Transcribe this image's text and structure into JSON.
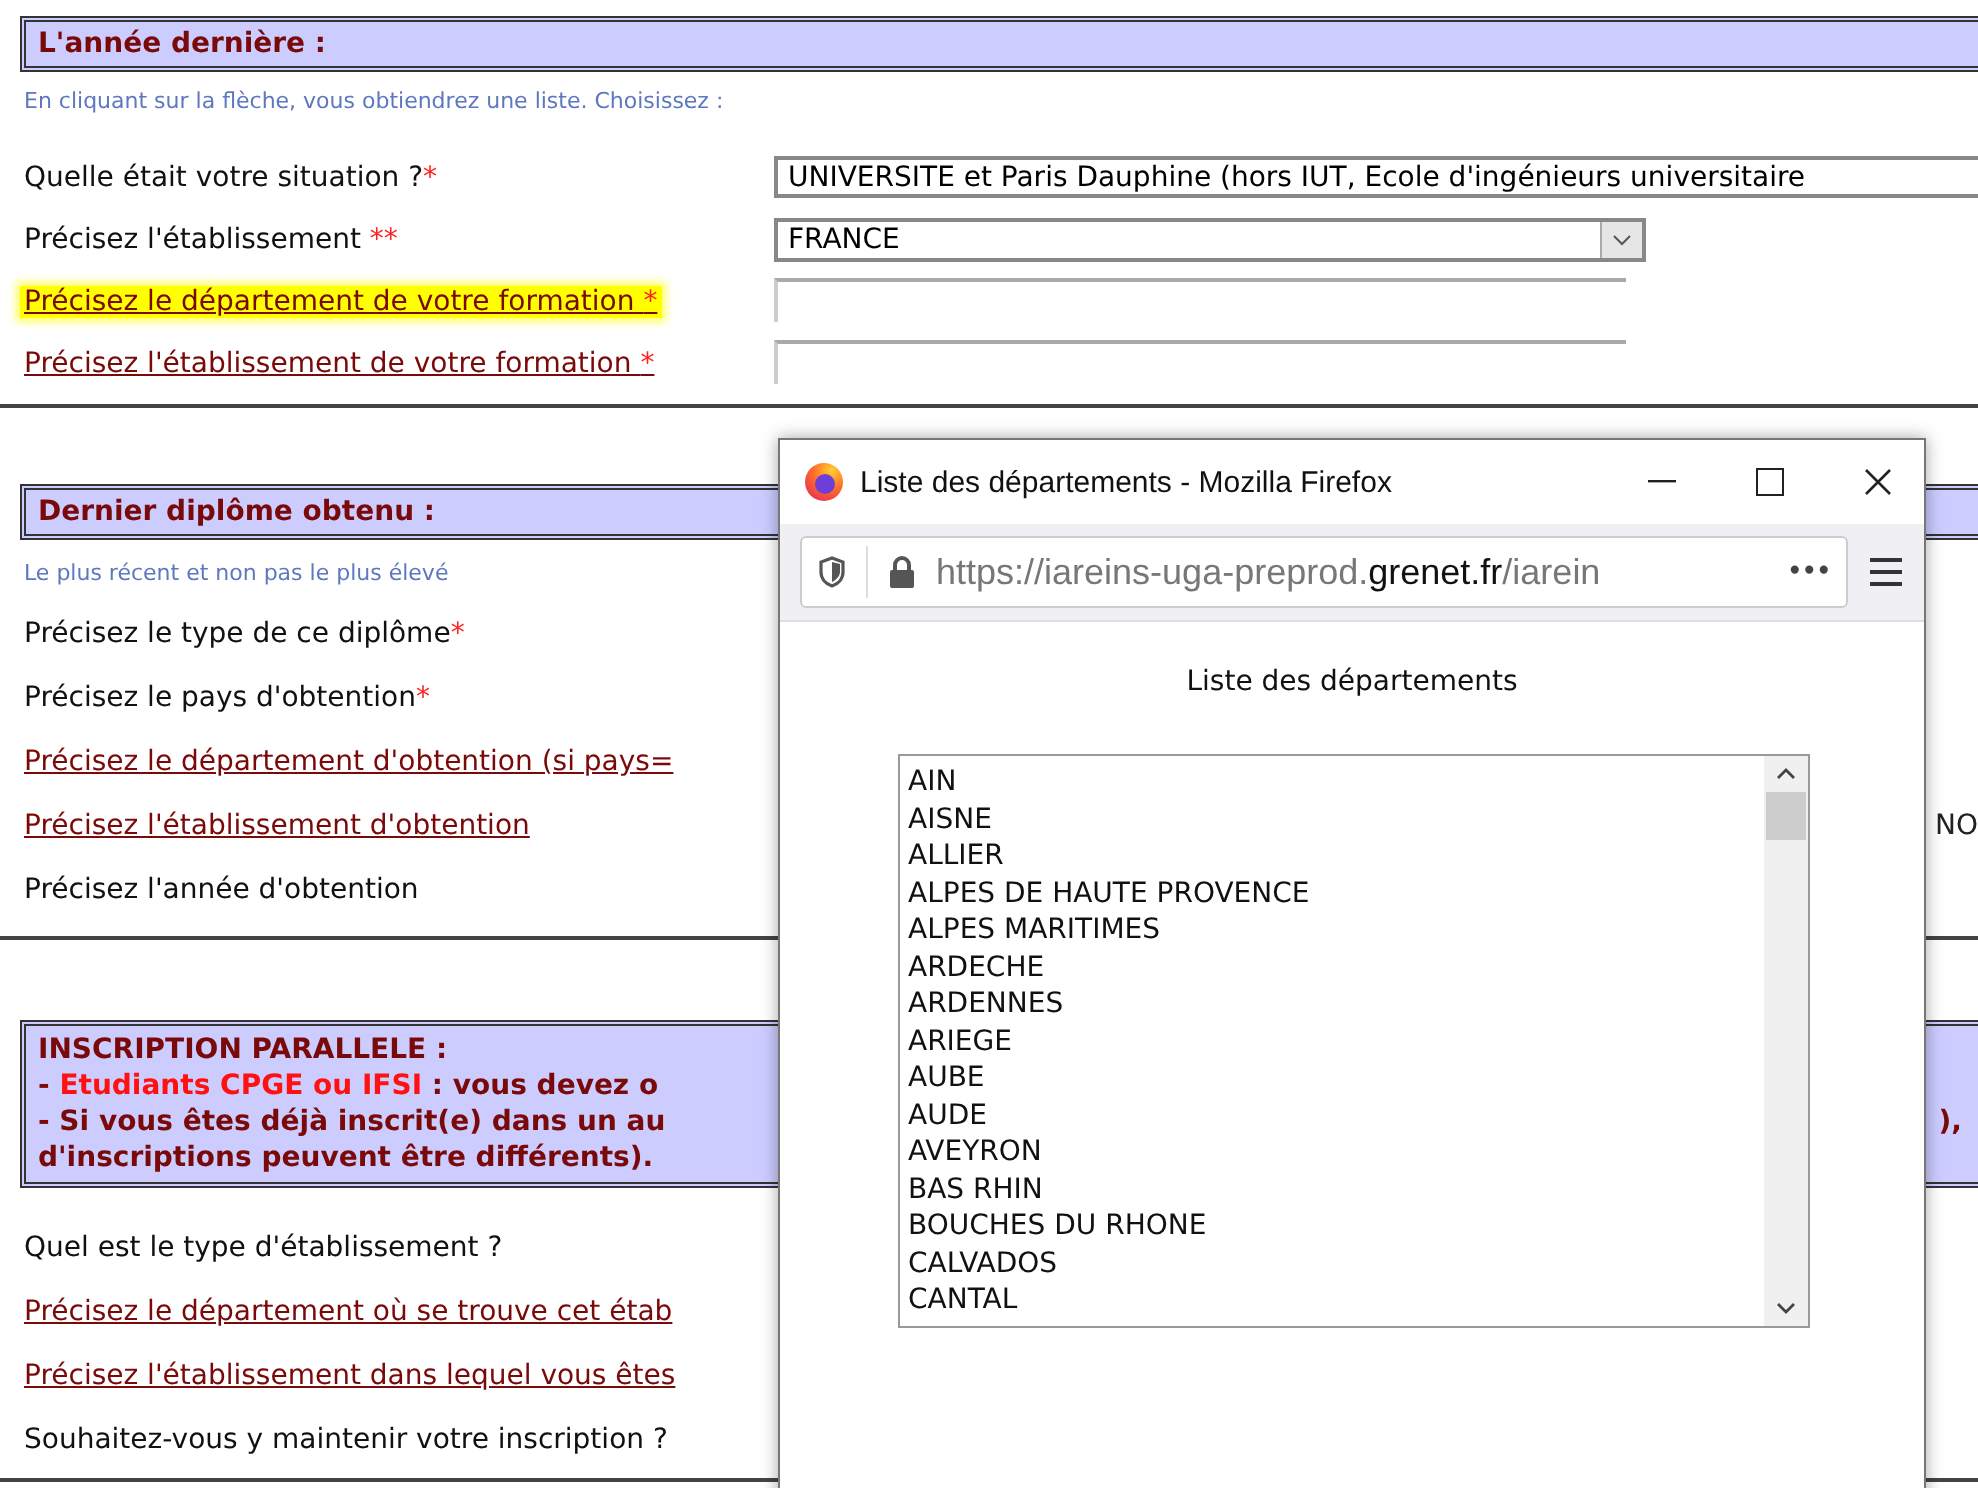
{
  "sections": [
    {
      "title_lines": [
        [
          {
            "text": "L'année dernière :"
          }
        ]
      ],
      "hint": "En cliquant sur la flèche, vous obtiendrez une liste. Choisissez :",
      "rows": [
        {
          "label": "Quelle était votre situation ?",
          "required": "*",
          "link": false,
          "highlighted": false,
          "field": {
            "kind": "wide-select",
            "value": "UNIVERSITE et Paris Dauphine (hors IUT, Ecole d'ingénieurs universitaire"
          }
        },
        {
          "label": "Précisez l'établissement ",
          "required": "**",
          "link": false,
          "highlighted": false,
          "field": {
            "kind": "select",
            "value": "FRANCE"
          }
        },
        {
          "label": "Précisez le département de votre formation ",
          "required": "*",
          "link": true,
          "highlighted": true,
          "field": {
            "kind": "text"
          }
        },
        {
          "label": "Précisez l'établissement de votre formation ",
          "required": "*",
          "link": true,
          "highlighted": false,
          "field": {
            "kind": "text"
          }
        }
      ]
    },
    {
      "title_lines": [
        [
          {
            "text": "Dernier diplôme obtenu :"
          }
        ]
      ],
      "hint": "Le plus récent et non pas le plus élevé",
      "rows": [
        {
          "label": "Précisez le type de ce diplôme",
          "required": "*",
          "link": false,
          "highlighted": false
        },
        {
          "label": "Précisez le pays d'obtention",
          "required": "*",
          "link": false,
          "highlighted": false
        },
        {
          "label": "Précisez le département d'obtention (si pays=",
          "link": true,
          "highlighted": false
        },
        {
          "label": "Précisez l'établissement d'obtention",
          "link": true,
          "highlighted": false,
          "right_text": "NO"
        },
        {
          "label": "Précisez l'année d'obtention",
          "link": false,
          "highlighted": false
        }
      ]
    },
    {
      "title_lines": [
        [
          {
            "text": "INSCRIPTION PARALLELE :"
          }
        ],
        [
          {
            "text": "- "
          },
          {
            "text": "Etudiants CPGE ou IFSI",
            "emphasis": true
          },
          {
            "text": " : vous devez o"
          }
        ],
        [
          {
            "text": "- Si vous êtes déjà inscrit(e) dans un au"
          },
          {
            "text": "),",
            "right": true
          }
        ],
        [
          {
            "text": "d'inscriptions peuvent être différents)."
          }
        ]
      ],
      "rows": [
        {
          "label": "Quel est le type d'établissement ?",
          "link": false,
          "highlighted": false
        },
        {
          "label": "Précisez le département où se trouve cet étab",
          "link": true,
          "highlighted": false
        },
        {
          "label": "Précisez l'établissement dans lequel vous êtes",
          "link": true,
          "highlighted": false
        },
        {
          "label": "Souhaitez-vous y maintenir votre inscription ?",
          "link": false,
          "highlighted": false
        }
      ]
    }
  ],
  "popup": {
    "title": "Liste des départements - Mozilla Firefox",
    "url_prefix": "https://iareins-uga-preprod.",
    "url_domain": "grenet.fr",
    "url_suffix": "/iarein",
    "more": "•••",
    "heading": "Liste des départements",
    "items": [
      "AIN",
      "AISNE",
      "ALLIER",
      "ALPES DE HAUTE PROVENCE",
      "ALPES MARITIMES",
      "ARDECHE",
      "ARDENNES",
      "ARIEGE",
      "AUBE",
      "AUDE",
      "AVEYRON",
      "BAS RHIN",
      "BOUCHES DU RHONE",
      "CALVADOS",
      "CANTAL"
    ]
  }
}
